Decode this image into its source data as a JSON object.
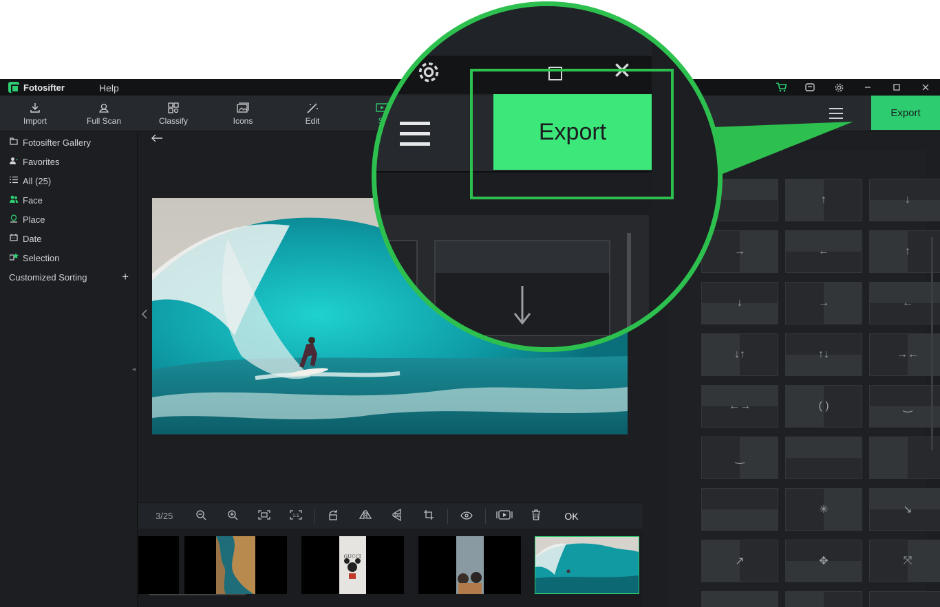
{
  "titlebar": {
    "app_name": "Fotosifter",
    "menu_help": "Help"
  },
  "toolbar": {
    "tools": [
      {
        "label": "Import",
        "icon": "import-icon"
      },
      {
        "label": "Full Scan",
        "icon": "scan-icon"
      },
      {
        "label": "Classify",
        "icon": "classify-icon"
      },
      {
        "label": "Icons",
        "icon": "icons-icon"
      },
      {
        "label": "Edit",
        "icon": "edit-icon"
      },
      {
        "label": "Sl",
        "icon": "slideshow-icon"
      }
    ],
    "export_label": "Export"
  },
  "sidebar": {
    "items": [
      {
        "label": "Fotosifter Gallery",
        "icon": "gallery-icon"
      },
      {
        "label": "Favorites",
        "icon": "favorites-icon"
      },
      {
        "label": "All (25)",
        "icon": "list-icon"
      },
      {
        "label": "Face",
        "icon": "face-icon"
      },
      {
        "label": "Place",
        "icon": "place-icon"
      },
      {
        "label": "Date",
        "icon": "date-icon"
      },
      {
        "label": "Selection",
        "icon": "selection-icon"
      },
      {
        "label": "Customized Sorting",
        "icon": "plus-icon"
      }
    ]
  },
  "viewer": {
    "counter": "3/25",
    "ok_label": "OK"
  },
  "magnifier": {
    "export_label": "Export"
  },
  "colors": {
    "accent": "#2ecc71",
    "callout": "#2ec04f"
  }
}
